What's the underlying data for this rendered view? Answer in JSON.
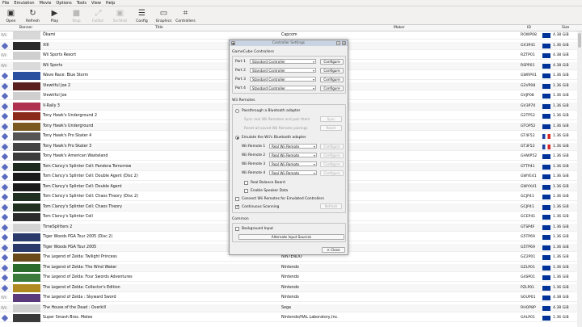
{
  "menu": [
    "File",
    "Emulation",
    "Movie",
    "Options",
    "Tools",
    "View",
    "Help"
  ],
  "toolbar": [
    {
      "label": "Open",
      "icon": "open-icon",
      "glyph": "▣",
      "disabled": false
    },
    {
      "label": "Refresh",
      "icon": "refresh-icon",
      "glyph": "↻",
      "disabled": false
    },
    {
      "label": "Play",
      "icon": "play-icon",
      "glyph": "▶",
      "disabled": false
    },
    {
      "label": "Stop",
      "icon": "stop-icon",
      "glyph": "■",
      "disabled": true
    },
    {
      "label": "FullScr",
      "icon": "fullscreen-icon",
      "glyph": "⤢",
      "disabled": true
    },
    {
      "label": "ScrShot",
      "icon": "screenshot-icon",
      "glyph": "▣",
      "disabled": true
    },
    {
      "label": "Config",
      "icon": "config-icon",
      "glyph": "☰",
      "disabled": false
    },
    {
      "label": "Graphics",
      "icon": "graphics-icon",
      "glyph": "▭",
      "disabled": false
    },
    {
      "label": "Controllers",
      "icon": "controllers-icon",
      "glyph": "⌗",
      "disabled": false
    }
  ],
  "columns": {
    "banner": "Banner",
    "title": "Title",
    "maker": "Maker",
    "id": "ID",
    "size": "Size"
  },
  "games": [
    {
      "platform": "Wii",
      "title": "Ōkami",
      "maker": "Capcom",
      "id": "ROWP08",
      "region": "eu",
      "size": "4.38 GiB",
      "banner": "#d8d8d8"
    },
    {
      "platform": "gc",
      "title": "XIII",
      "maker": "",
      "id": "GX3P41",
      "region": "eu",
      "size": "1.36 GiB",
      "banner": "#2a2a2a"
    },
    {
      "platform": "Wii",
      "title": "Wii Sports Resort",
      "maker": "",
      "id": "RZTP01",
      "region": "eu",
      "size": "4.38 GiB",
      "banner": "#cfcfcf"
    },
    {
      "platform": "Wii",
      "title": "Wii Sports",
      "maker": "",
      "id": "RSPP01",
      "region": "eu",
      "size": "4.38 GiB",
      "banner": "#dadada"
    },
    {
      "platform": "gc",
      "title": "Wave Race: Blue Storm",
      "maker": "",
      "id": "GWRP01",
      "region": "eu",
      "size": "1.36 GiB",
      "banner": "#2b4fa0"
    },
    {
      "platform": "gc",
      "title": "Viewtiful Joe 2",
      "maker": "",
      "id": "G2VP08",
      "region": "eu",
      "size": "1.36 GiB",
      "banner": "#5a2020"
    },
    {
      "platform": "gc",
      "title": "Viewtiful Joe",
      "maker": "",
      "id": "GVJP08",
      "region": "eu",
      "size": "1.36 GiB",
      "banner": "#cfcfcf"
    },
    {
      "platform": "gc",
      "title": "V-Rally 3",
      "maker": "",
      "id": "GV3P70",
      "region": "eu",
      "size": "1.36 GiB",
      "banner": "#b03050"
    },
    {
      "platform": "gc",
      "title": "Tony Hawk's Underground 2",
      "maker": "",
      "id": "G2TP52",
      "region": "eu",
      "size": "1.36 GiB",
      "banner": "#8a2a1a"
    },
    {
      "platform": "gc",
      "title": "Tony Hawk's Underground",
      "maker": "",
      "id": "GTOP52",
      "region": "eu",
      "size": "1.36 GiB",
      "banner": "#7a5a20"
    },
    {
      "platform": "gc",
      "title": "Tony Hawk's Pro Skater 4",
      "maker": "",
      "id": "GT4F52",
      "region": "fr",
      "size": "1.36 GiB",
      "banner": "#555555"
    },
    {
      "platform": "gc",
      "title": "Tony Hawk's Pro Skater 3",
      "maker": "...eservés.",
      "id": "GT3F52",
      "region": "fr",
      "size": "1.36 GiB",
      "banner": "#444444"
    },
    {
      "platform": "gc",
      "title": "Tony Hawk's American Wasteland",
      "maker": "",
      "id": "GHWP52",
      "region": "eu",
      "size": "1.36 GiB",
      "banner": "#3a3a3a"
    },
    {
      "platform": "gc",
      "title": "Tom Clancy's Splinter Cell: Pandora Tomorrow",
      "maker": "",
      "id": "GTTP41",
      "region": "eu",
      "size": "1.36 GiB",
      "banner": "#1e2a1e"
    },
    {
      "platform": "gc",
      "title": "Tom Clancy's Splinter Cell: Double Agent (Disc 2)",
      "maker": "",
      "id": "GWYE41",
      "region": "eu",
      "size": "1.36 GiB",
      "banner": "#1a1a1a"
    },
    {
      "platform": "gc",
      "title": "Tom Clancy's Splinter Cell: Double Agent",
      "maker": "",
      "id": "GWYX41",
      "region": "eu",
      "size": "1.36 GiB",
      "banner": "#1a1a1a"
    },
    {
      "platform": "gc",
      "title": "Tom Clancy's Splinter Cell: Chaos Theory (Disc 2)",
      "maker": "",
      "id": "GCJP41",
      "region": "eu",
      "size": "1.36 GiB",
      "banner": "#203020"
    },
    {
      "platform": "gc",
      "title": "Tom Clancy's Splinter Cell: Chaos Theory",
      "maker": "",
      "id": "GCJP41",
      "region": "eu",
      "size": "1.36 GiB",
      "banner": "#203020"
    },
    {
      "platform": "gc",
      "title": "Tom Clancy's Splinter Cell",
      "maker": "",
      "id": "GCEP41",
      "region": "eu",
      "size": "1.36 GiB",
      "banner": "#2a2a2a"
    },
    {
      "platform": "gc",
      "title": "TimeSplitters 2",
      "maker": "",
      "id": "GTSP4F",
      "region": "eu",
      "size": "1.36 GiB",
      "banner": "#d4d4d4"
    },
    {
      "platform": "gc",
      "title": "Tiger Woods PGA Tour 2005 (Disc 2)",
      "maker": "",
      "id": "G5TP69",
      "region": "eu",
      "size": "1.36 GiB",
      "banner": "#2a3a6a"
    },
    {
      "platform": "gc",
      "title": "Tiger Woods PGA Tour 2005",
      "maker": "",
      "id": "G5TP69",
      "region": "eu",
      "size": "1.36 GiB",
      "banner": "#2a3a6a"
    },
    {
      "platform": "gc",
      "title": "The Legend of Zelda: Twilight Princess",
      "maker": "NINTENDO",
      "id": "GZ2P01",
      "region": "eu",
      "size": "1.36 GiB",
      "banner": "#6a4a1a"
    },
    {
      "platform": "gc",
      "title": "The Legend of Zelda: The Wind Waker",
      "maker": "Nintendo",
      "id": "GZLP01",
      "region": "eu",
      "size": "1.36 GiB",
      "banner": "#2a6a2a"
    },
    {
      "platform": "gc",
      "title": "The Legend of Zelda: Four Swords Adventures",
      "maker": "Nintendo",
      "id": "G4SP01",
      "region": "eu",
      "size": "1.36 GiB",
      "banner": "#3a7a3a"
    },
    {
      "platform": "gc",
      "title": "The Legend of Zelda: Collector's Edition",
      "maker": "Nintendo",
      "id": "PZLP01",
      "region": "eu",
      "size": "1.36 GiB",
      "banner": "#b08a20"
    },
    {
      "platform": "Wii",
      "title": "The Legend of Zelda : Skyward Sword",
      "maker": "Nintendo",
      "id": "SOUP01",
      "region": "eu",
      "size": "4.38 GiB",
      "banner": "#5a3a7a"
    },
    {
      "platform": "Wii",
      "title": "The House of the Dead : Overkill",
      "maker": "Sega",
      "id": "RHOP8P",
      "region": "eu",
      "size": "4.38 GiB",
      "banner": "#cfcfcf"
    },
    {
      "platform": "gc",
      "title": "Super Smash Bros. Melee",
      "maker": "Nintendo/HAL Laboratory,Inc.",
      "id": "GALP01",
      "region": "eu",
      "size": "1.36 GiB",
      "banner": "#3a3a3a"
    }
  ],
  "dialog": {
    "title": "Controller Settings",
    "gc_section": "GameCube Controllers",
    "ports": [
      {
        "label": "Port 1",
        "value": "Standard Controller",
        "button": "Configure"
      },
      {
        "label": "Port 2",
        "value": "Standard Controller",
        "button": "Configure"
      },
      {
        "label": "Port 3",
        "value": "Standard Controller",
        "button": "Configure"
      },
      {
        "label": "Port 4",
        "value": "Standard Controller",
        "button": "Configure"
      }
    ],
    "wii_section": "Wii Remotes",
    "passthrough": "Passthrough a Bluetooth adapter",
    "sync_text": "Sync real Wii Remotes and pair them",
    "sync_button": "Sync",
    "reset_text": "Reset all saved Wii Remote pairings",
    "reset_button": "Reset",
    "emulate": "Emulate the Wii's Bluetooth adapter",
    "remotes": [
      {
        "label": "Wii Remote 1",
        "value": "Real Wii Remote",
        "button": "Configure"
      },
      {
        "label": "Wii Remote 2",
        "value": "Real Wii Remote",
        "button": "Configure"
      },
      {
        "label": "Wii Remote 3",
        "value": "Real Wii Remote",
        "button": "Configure"
      },
      {
        "label": "Wii Remote 4",
        "value": "Real Wii Remote",
        "button": "Configure"
      }
    ],
    "balance_board": "Real Balance Board",
    "speaker": "Enable Speaker Data",
    "connect": "Connect Wii Remotes for Emulated Controllers",
    "scanning": "Continuous Scanning",
    "refresh_button": "Refresh",
    "common_section": "Common",
    "background_input": "Background Input",
    "alt_sources": "Alternate Input Sources",
    "close": "Close"
  }
}
